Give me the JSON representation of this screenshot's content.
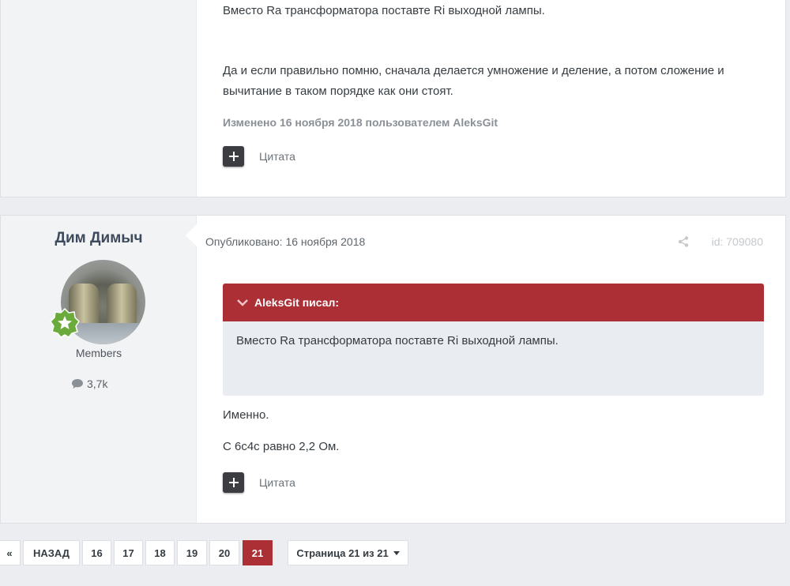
{
  "post1": {
    "line1": "Вместо Ra трансформатора поставте Ri выходной лампы.",
    "line2": "Да и если правильно помню, сначала делается умножение и деление, а потом сложение и",
    "line3": "вычитание в таком порядке как они стоят.",
    "edited": "Изменено 16 ноября 2018 пользователем AleksGit",
    "quote_label": "Цитата"
  },
  "post2": {
    "author": "Дим Димыч",
    "role": "Members",
    "reputation": "3,7k",
    "published": "Опубликовано: 16 ноября 2018",
    "post_id": "id: 709080",
    "quote": {
      "header": "AleksGit писал:",
      "text": "Вместо Ra трансформатора поставте Ri выходной лампы."
    },
    "text1": "Именно.",
    "text2": "С 6с4с равно 2,2 Ом.",
    "quote_label": "Цитата"
  },
  "pagination": {
    "first": "«",
    "prev": "НАЗАД",
    "pages": [
      "16",
      "17",
      "18",
      "19",
      "20",
      "21"
    ],
    "active_page": "21",
    "page_select": "Страница 21 из 21"
  },
  "colors": {
    "accent": "#ad2f36",
    "background": "#ebedf0"
  },
  "icons": {
    "plus": "plus-icon",
    "share": "share-icon",
    "comment": "comment-icon",
    "chevron": "chevron-down-icon",
    "badge": "star-badge-icon"
  }
}
